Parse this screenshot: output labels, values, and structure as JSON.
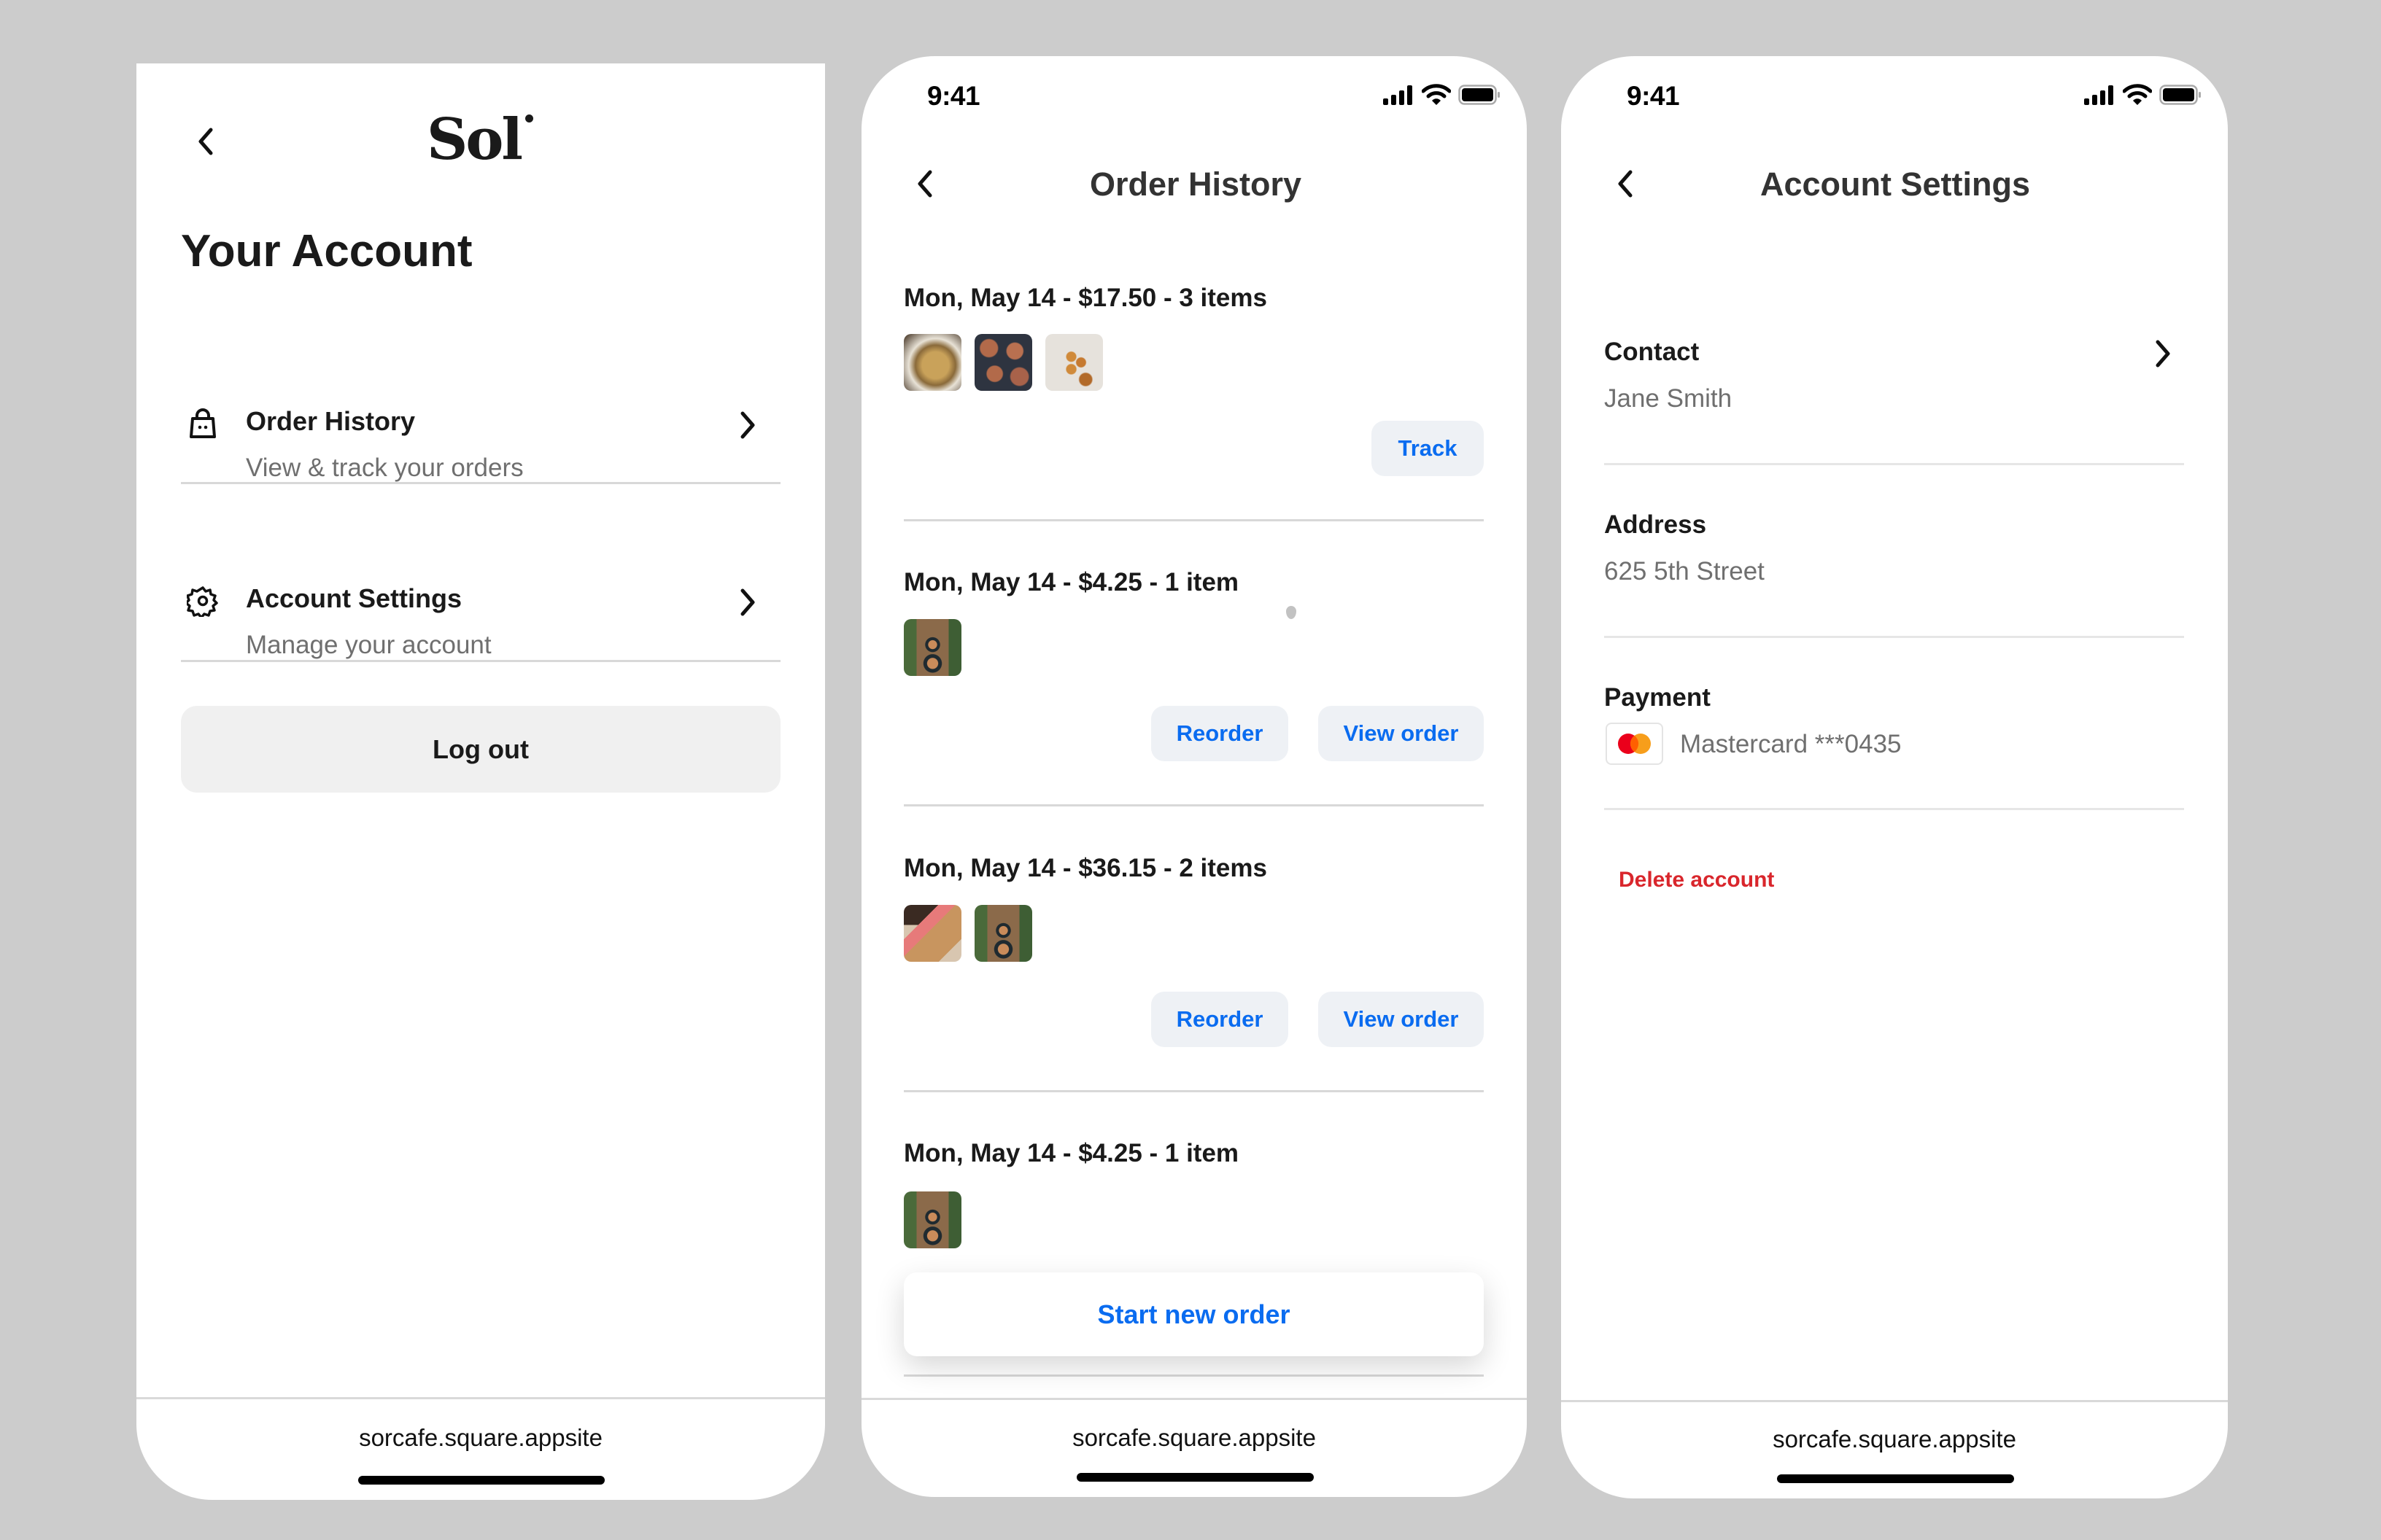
{
  "colors": {
    "background": "#cccccc",
    "accent_blue": "#0a6cf0",
    "danger_red": "#d9262c",
    "secondary_text": "#6f6f6f",
    "button_bg": "#eef1f5"
  },
  "status_bar": {
    "time": "9:41",
    "icons": [
      "cellular-signal-icon",
      "wifi-icon",
      "battery-icon"
    ]
  },
  "footer": {
    "url": "sorcafe.square.appsite"
  },
  "account_screen": {
    "back_icon": "chevron-left-icon",
    "logo": "Sol",
    "heading": "Your Account",
    "items": [
      {
        "icon": "shopping-bag-icon",
        "title": "Order History",
        "subtitle": "View & track your orders"
      },
      {
        "icon": "gear-icon",
        "title": "Account Settings",
        "subtitle": "Manage your account"
      }
    ],
    "logout_label": "Log out"
  },
  "orders_screen": {
    "title": "Order History",
    "orders": [
      {
        "summary": "Mon, May 14 - $17.50 - 3 items",
        "thumbnails": [
          "bread-loaf",
          "cinnamon-rolls",
          "pastry-balls"
        ],
        "actions": [
          "Track"
        ]
      },
      {
        "summary": "Mon, May 14 - $4.25 - 1 item",
        "thumbnails": [
          "latte-cups"
        ],
        "actions": [
          "Reorder",
          "View order"
        ]
      },
      {
        "summary": "Mon, May 14 - $36.15 - 2 items",
        "thumbnails": [
          "coffee-bag",
          "latte-cups"
        ],
        "actions": [
          "Reorder",
          "View order"
        ]
      },
      {
        "summary": "Mon, May 14 - $4.25 - 1 item",
        "thumbnails": [
          "latte-cups"
        ],
        "actions": []
      }
    ],
    "start_new_order_label": "Start new order"
  },
  "settings_screen": {
    "title": "Account Settings",
    "contact": {
      "label": "Contact",
      "value": "Jane Smith"
    },
    "address": {
      "label": "Address",
      "value": "625 5th Street"
    },
    "payment": {
      "label": "Payment",
      "card_brand_icon": "mastercard-icon",
      "value": "Mastercard ***0435"
    },
    "delete_label": "Delete account"
  }
}
